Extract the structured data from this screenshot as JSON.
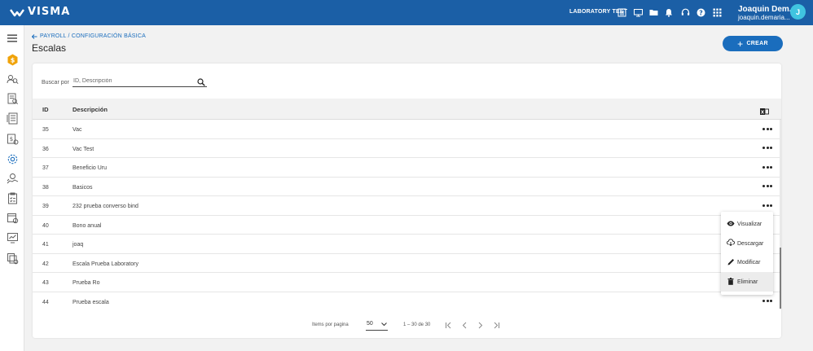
{
  "brand": {
    "name": "VISMA"
  },
  "topbar": {
    "company": "LABORATORY TEST",
    "user_name": "Joaquin Dem...",
    "user_email": "joaquin.demaria...",
    "avatar_initial": "J",
    "icons": [
      "company-list-icon",
      "monitor-icon",
      "folder-icon",
      "bell-icon",
      "headset-icon",
      "help-icon",
      "apps-grid-icon"
    ]
  },
  "sidebar": {
    "icons": [
      "hamburger-menu-icon",
      "coin-icon",
      "people-search-icon",
      "document-search-icon",
      "report-icon",
      "money-settings-icon",
      "settings-gear-icon",
      "payroll-hands-icon",
      "checklist-icon",
      "calendar-settings-icon",
      "monitor-chart-icon",
      "stacked-documents-icon"
    ]
  },
  "breadcrumb": {
    "text": "PAYROLL / CONFIGURACIÓN BÁSICA"
  },
  "page": {
    "title": "Escalas",
    "create_label": "CREAR"
  },
  "search": {
    "label": "Buscar por",
    "placeholder": "ID, Descripción"
  },
  "table": {
    "headers": {
      "id": "ID",
      "desc": "Descripción"
    },
    "rows": [
      {
        "id": "35",
        "desc": "Vac"
      },
      {
        "id": "36",
        "desc": "Vac Test"
      },
      {
        "id": "37",
        "desc": "Beneficio Uru"
      },
      {
        "id": "38",
        "desc": "Basicos"
      },
      {
        "id": "39",
        "desc": "232 prueba converso bind"
      },
      {
        "id": "40",
        "desc": "Bono anual"
      },
      {
        "id": "41",
        "desc": "joaq"
      },
      {
        "id": "42",
        "desc": "Escala Prueba Laboratory"
      },
      {
        "id": "43",
        "desc": "Prueba Ro"
      },
      {
        "id": "44",
        "desc": "Prueba escala"
      }
    ]
  },
  "context_menu": {
    "items": [
      {
        "label": "Visualizar",
        "icon": "eye-icon"
      },
      {
        "label": "Descargar",
        "icon": "cloud-download-icon"
      },
      {
        "label": "Modificar",
        "icon": "pencil-icon"
      },
      {
        "label": "Eliminar",
        "icon": "trash-icon"
      }
    ]
  },
  "pagination": {
    "items_label": "Items por pagina",
    "page_size": "50",
    "range": "1 – 30 de 30"
  },
  "colors": {
    "topbar": "#1b5fa6",
    "accent": "#1a6dbd",
    "avatar": "#40c4e0"
  }
}
